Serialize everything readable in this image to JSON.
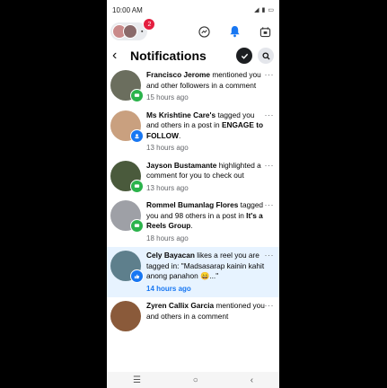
{
  "status_bar": {
    "time": "10:00 AM",
    "battery": "70"
  },
  "topnav": {
    "notification_count": "2"
  },
  "header": {
    "title": "Notifications"
  },
  "notifications": [
    {
      "name": "Francisco Jerome",
      "text": " mentioned you and other followers in a comment",
      "extra": "",
      "time": "15 hours ago",
      "unread": false,
      "avatar_color": "#6b6e5e",
      "badge": "green"
    },
    {
      "name": "Ms Krishtine Care's",
      "text": " tagged you and others in a post in ",
      "extra": "ENGAGE to FOLLOW",
      "suffix": ".",
      "time": "13 hours ago",
      "unread": false,
      "avatar_color": "#c9a07f",
      "badge": "blue"
    },
    {
      "name": "Jayson Bustamante",
      "text": " highlighted a comment for you to check out",
      "extra": "",
      "time": "13 hours ago",
      "unread": false,
      "avatar_color": "#4a5a3c",
      "badge": "green"
    },
    {
      "name": "Rommel Bumanlag Flores",
      "text": " tagged you and 98 others in a post in ",
      "extra": "It's a Reels Group",
      "suffix": ".",
      "time": "18 hours ago",
      "unread": false,
      "avatar_color": "#9ea0a6",
      "badge": "green"
    },
    {
      "name": "Cely Bayacan",
      "text": " likes a reel you are tagged in: \"Madsasarap kainin kahit anong panahon 😄...\"",
      "extra": "",
      "time": "14 hours ago",
      "unread": true,
      "avatar_color": "#5e7f8c",
      "badge": "blue"
    },
    {
      "name": "Zyren Callix Garcia",
      "text": " mentioned you and others in a comment",
      "extra": "",
      "time": "",
      "unread": false,
      "avatar_color": "#8a5a3a",
      "badge": "green"
    }
  ],
  "more_label": "···",
  "nav": {
    "recents": "☰",
    "home": "○",
    "back": "‹"
  }
}
